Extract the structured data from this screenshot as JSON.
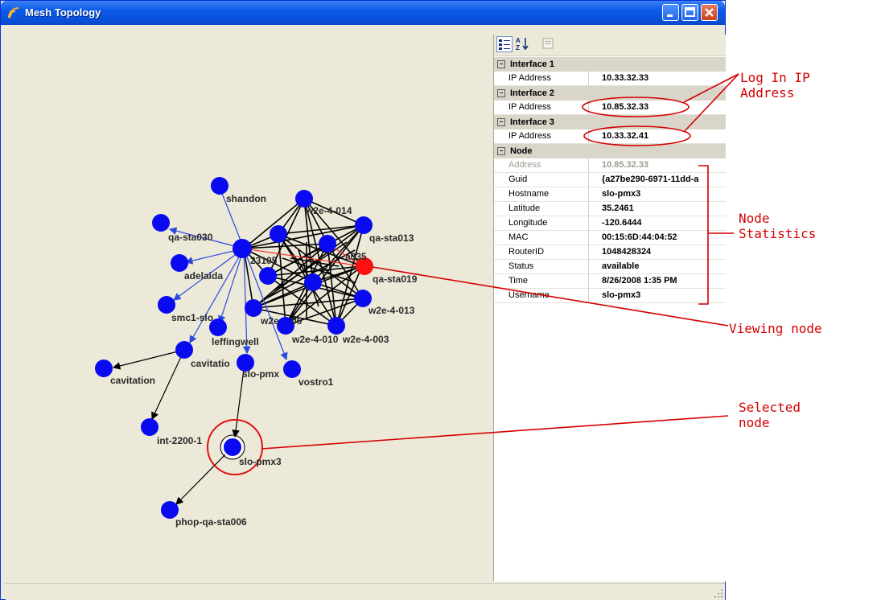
{
  "window": {
    "title": "Mesh Topology"
  },
  "toolbar": {
    "categorized": "categorized-icon",
    "alphabetical": "sort-az-icon",
    "pages": "property-pages-icon"
  },
  "properties": {
    "interface1": {
      "title": "Interface 1",
      "ip_label": "IP Address",
      "ip": "10.33.32.33"
    },
    "interface2": {
      "title": "Interface 2",
      "ip_label": "IP Address",
      "ip": "10.85.32.33"
    },
    "interface3": {
      "title": "Interface 3",
      "ip_label": "IP Address",
      "ip": "10.33.32.41"
    },
    "node": {
      "title": "Node",
      "rows": [
        {
          "k": "Address",
          "v": "10.85.32.33"
        },
        {
          "k": "Guid",
          "v": "{a27be290-6971-11dd-a"
        },
        {
          "k": "Hostname",
          "v": "slo-pmx3"
        },
        {
          "k": "Latitude",
          "v": "35.2461"
        },
        {
          "k": "Longitude",
          "v": "-120.6444"
        },
        {
          "k": "MAC",
          "v": "00:15:6D:44:04:52"
        },
        {
          "k": "RouterID",
          "v": "1048428324"
        },
        {
          "k": "Status",
          "v": "available"
        },
        {
          "k": "Time",
          "v": "8/26/2008 1:35 PM"
        },
        {
          "k": "Username",
          "v": "slo-pmx3"
        }
      ]
    }
  },
  "graph": {
    "labels": {
      "shandon": "shandon",
      "w2e014": "w2e-4-014",
      "qa_sta030": "qa-sta030",
      "qa_sta013": "qa-sta013",
      "vb23": "23105",
      "sta035": "a035",
      "adelaida": "adelaida",
      "qa_sta019": "qa-sta019",
      "w2e013": "w2e-4-013",
      "smc1": "smc1-slo",
      "w2e06": "w2e",
      "x06": "06",
      "leffingwell": "leffingwell",
      "w2e010": "w2e-4-010",
      "w2e003": "w2e-4-003",
      "cavitation_top": "cavitatio",
      "slo_pmx_top": "slo-pmx",
      "vostro1": "vostro1",
      "cavitation": "cavitation",
      "int2200": "int-2200-1",
      "slo_pmx3": "slo-pmx3",
      "phop": "phop-qa-sta006"
    }
  },
  "annotations": {
    "login_ip": "Log In IP\nAddress",
    "node_stats": "Node\nStatistics",
    "viewing": "Viewing node",
    "selected": "Selected\nnode"
  },
  "colors": {
    "node": "#0a0af0",
    "viewing_node": "#ff1010",
    "annotation": "#d40000",
    "edge_blue": "#2a48e0"
  }
}
